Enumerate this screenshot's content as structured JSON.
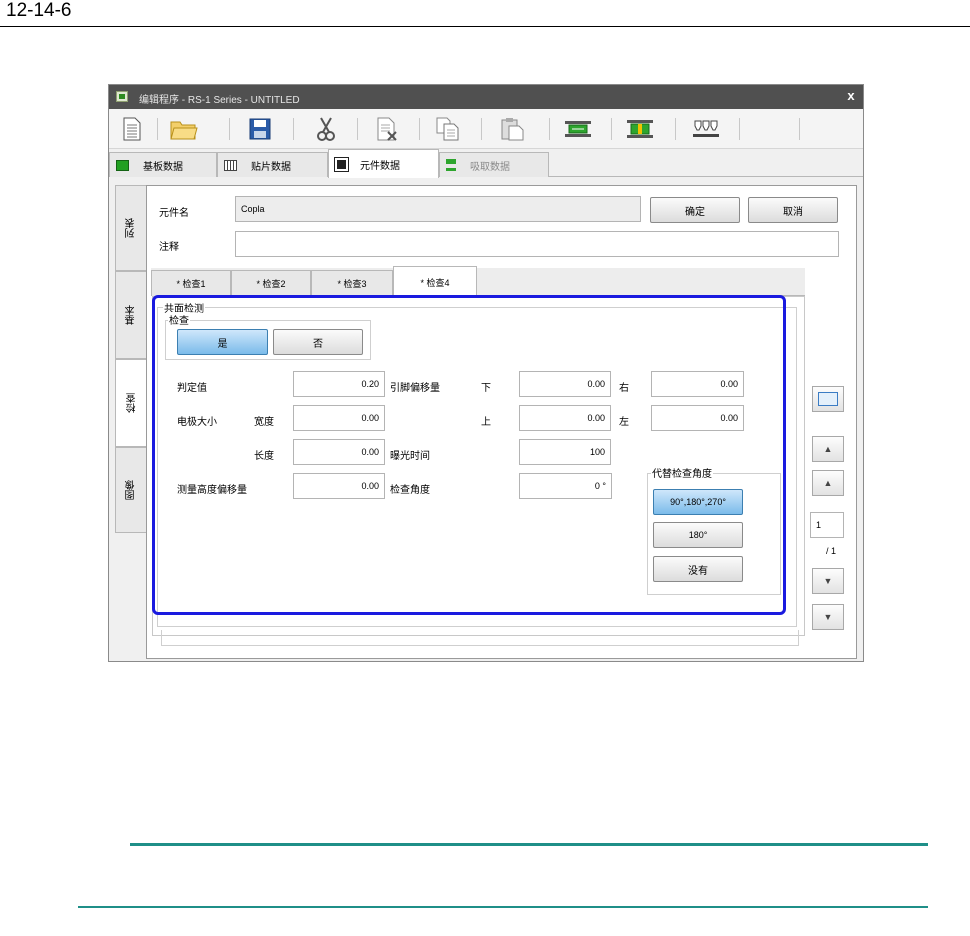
{
  "document": {
    "page_number": "12-14-6"
  },
  "window": {
    "title": "编辑程序 - RS-1 Series - UNTITLED",
    "close": "x"
  },
  "toolbar": {
    "icons": [
      "new-document-icon",
      "open-folder-icon",
      "save-icon",
      "cut-icon",
      "delete-icon",
      "copy-icon",
      "paste-icon",
      "board-icon",
      "component-icon",
      "nozzle-icon"
    ]
  },
  "main_tabs": [
    {
      "label": "基板数据",
      "icon": "board-data-icon"
    },
    {
      "label": "贴片数据",
      "icon": "placement-data-icon"
    },
    {
      "label": "元件数据",
      "icon": "component-data-icon"
    },
    {
      "label": "吸取数据",
      "icon": "pickup-data-icon"
    }
  ],
  "side_tabs": [
    "列表",
    "基本",
    "检查",
    "图像"
  ],
  "component": {
    "name_label": "元件名",
    "name_value": "Copla",
    "comment_label": "注释",
    "comment_value": "",
    "ok_label": "确定",
    "cancel_label": "取消"
  },
  "sub_tabs": [
    "* 检查1",
    "* 检查2",
    "* 检查3",
    "* 检查4"
  ],
  "coplanarity": {
    "group_title": "共面检测",
    "inspect_title": "检查",
    "yes_label": "是",
    "no_label": "否",
    "judge_label": "判定值",
    "judge_value": "0.20",
    "lead_offset_label": "引脚偏移量",
    "down_label": "下",
    "down_value": "0.00",
    "right_label": "右",
    "right_value": "0.00",
    "electrode_size_label": "电极大小",
    "width_label": "宽度",
    "width_value": "0.00",
    "up_label": "上",
    "up_value": "0.00",
    "left_label": "左",
    "left_value": "0.00",
    "length_label": "长度",
    "length_value": "0.00",
    "exposure_label": "曝光时间",
    "exposure_value": "100",
    "height_offset_label": "测量高度偏移量",
    "height_offset_value": "0.00",
    "angle_label": "检查角度",
    "angle_value": "0 °"
  },
  "alt_angle": {
    "title": "代替检查角度",
    "opt1": "90°,180°,270°",
    "opt2": "180°",
    "opt3": "没有"
  },
  "nav": {
    "page_value": "1",
    "page_total": "/ 1"
  },
  "colors": {
    "highlight": "#1a1adf",
    "selected_button": "#7bbbea",
    "title_bar": "#505050",
    "rule": "#1f8f88"
  }
}
